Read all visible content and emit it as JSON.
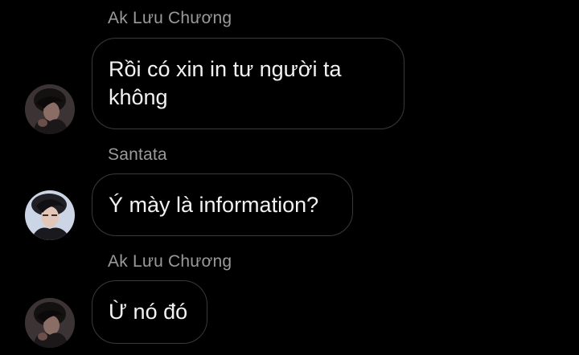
{
  "messages": [
    {
      "sender": "Ak Lưu Chương",
      "text": "Rồi có xin in tư người ta không",
      "avatar_icon": "user-avatar-dark-icon"
    },
    {
      "sender": "Santata",
      "text": "Ý mày là information?",
      "avatar_icon": "user-avatar-light-icon"
    },
    {
      "sender": "Ak Lưu Chương",
      "text": "Ừ nó đó",
      "avatar_icon": "user-avatar-dark-icon"
    }
  ],
  "colors": {
    "background": "#000000",
    "bubble_border": "#3a3a3a",
    "message_text": "#f2f2f2",
    "sender_text": "#9a9a9a"
  }
}
